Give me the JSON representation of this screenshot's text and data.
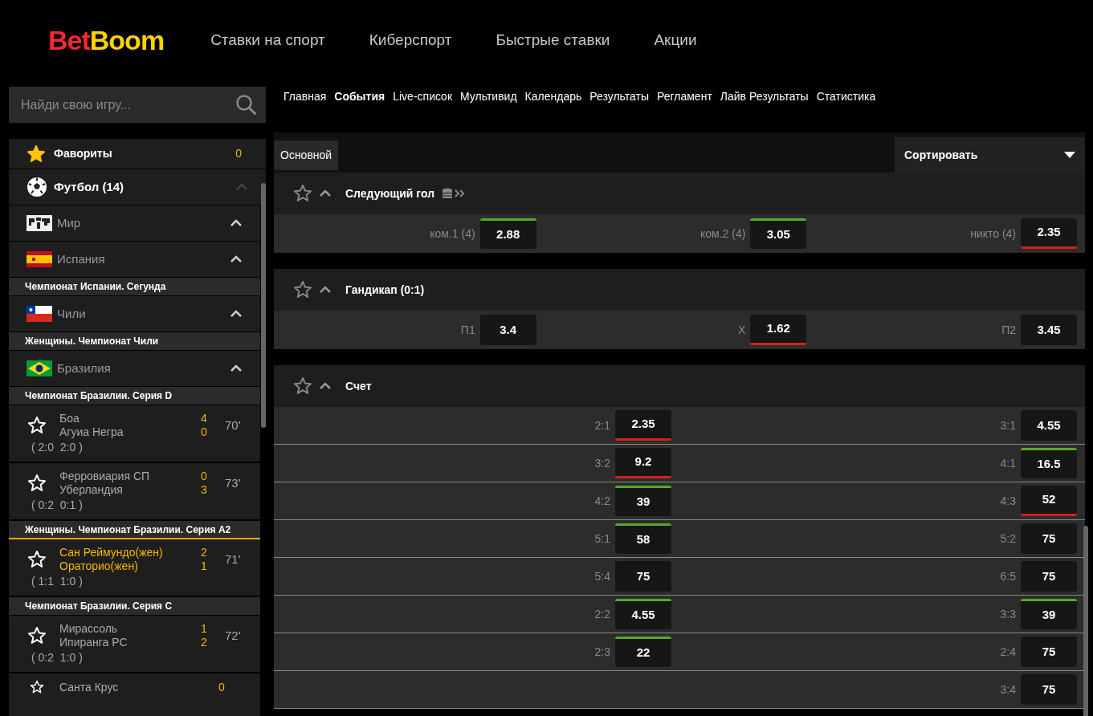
{
  "logo": {
    "parts": [
      {
        "text": "Bet",
        "color": "#ee2a35"
      },
      {
        "text": "Boom",
        "color": "#ffd200"
      }
    ]
  },
  "top_nav": [
    {
      "label": "Ставки на спорт"
    },
    {
      "label": "Киберспорт"
    },
    {
      "label": "Быстрые ставки"
    },
    {
      "label": "Акции"
    }
  ],
  "search": {
    "placeholder": "Найди свою игру..."
  },
  "sub_nav": [
    {
      "label": "Главная",
      "selected": false
    },
    {
      "label": "События",
      "selected": true
    },
    {
      "label": "Live-список",
      "selected": false
    },
    {
      "label": "Мультивид",
      "selected": false
    },
    {
      "label": "Календарь",
      "selected": false
    },
    {
      "label": "Результаты",
      "selected": false
    },
    {
      "label": "Регламент",
      "selected": false
    },
    {
      "label": "Лайв Результаты",
      "selected": false
    },
    {
      "label": "Статистика",
      "selected": false
    }
  ],
  "sidebar": {
    "items": [
      {
        "kind": "favorites",
        "label": "Фавориты",
        "count": "0"
      },
      {
        "kind": "sport",
        "label": "Футбол (14)",
        "expanded": true
      },
      {
        "kind": "country",
        "label": "Мир",
        "expanded": true
      },
      {
        "kind": "country",
        "label": "Испания",
        "expanded": true
      },
      {
        "kind": "league",
        "label": "Чемпионат Испании. Сегунда",
        "selected": false
      },
      {
        "kind": "country",
        "label": "Чили",
        "expanded": true
      },
      {
        "kind": "league",
        "label": "Женщины. Чемпионат Чили",
        "selected": false
      },
      {
        "kind": "country",
        "label": "Бразилия",
        "expanded": true
      },
      {
        "kind": "league",
        "label": "Чемпионат Бразилии. Серия D",
        "selected": false
      },
      {
        "kind": "match",
        "favorite": false,
        "selected": false,
        "team1": "Боа",
        "team2": "Агуиа Негра",
        "score1": "4",
        "score2": "0",
        "time": "70'",
        "periods": "( 2:0  2:0 )"
      },
      {
        "kind": "match",
        "favorite": false,
        "selected": false,
        "team1": "Ферровиария СП",
        "team2": "Уберландия",
        "score1": "0",
        "score2": "3",
        "time": "73'",
        "periods": "( 0:2  0:1 )"
      },
      {
        "kind": "league",
        "label": "Женщины. Чемпионат Бразилии. Серия А2",
        "selected": true
      },
      {
        "kind": "match",
        "favorite": false,
        "selected": true,
        "team1": "Сан Реймундо(жен)",
        "team2": "Ораторио(жен)",
        "score1": "2",
        "score2": "1",
        "time": "71'",
        "periods": "( 1:1  1:0 )"
      },
      {
        "kind": "league",
        "label": "Чемпионат Бразилии. Серия С",
        "selected": false
      },
      {
        "kind": "match",
        "favorite": false,
        "selected": false,
        "team1": "Мирассоль",
        "team2": "Ипиранга РС",
        "score1": "1",
        "score2": "2",
        "time": "72'",
        "periods": "( 0:2  1:0 )"
      },
      {
        "kind": "match",
        "favorite": false,
        "selected": false,
        "team1": "Санта Крус",
        "score1": "0"
      }
    ]
  },
  "main": {
    "tab": {
      "label": "Основной",
      "selected": true
    },
    "sort": {
      "label": "Сортировать"
    },
    "markets": [
      {
        "title": "Следующий гол",
        "favorite": false,
        "expanded": true,
        "coins_icon": true,
        "rows": [
          [
            {
              "label": "ком.1 (4)",
              "odds": "2.88",
              "rising": true,
              "falling": false
            },
            {
              "label": "ком.2 (4)",
              "odds": "3.05",
              "rising": true,
              "falling": false
            },
            {
              "label": "никто (4)",
              "odds": "2.35",
              "rising": false,
              "falling": true
            }
          ]
        ]
      },
      {
        "title": "Гандикап (0:1)",
        "favorite": false,
        "expanded": true,
        "coins_icon": false,
        "rows": [
          [
            {
              "label": "П1",
              "odds": "3.4",
              "rising": false,
              "falling": false
            },
            {
              "label": "X",
              "odds": "1.62",
              "rising": false,
              "falling": true
            },
            {
              "label": "П2",
              "odds": "3.45",
              "rising": false,
              "falling": false
            }
          ]
        ]
      },
      {
        "title": "Счет",
        "favorite": false,
        "expanded": true,
        "coins_icon": false,
        "rows": [
          [
            {
              "label": "2:1",
              "odds": "2.35",
              "rising": false,
              "falling": true
            },
            {
              "label": "3:1",
              "odds": "4.55",
              "rising": false,
              "falling": false
            }
          ],
          [
            {
              "label": "3:2",
              "odds": "9.2",
              "rising": false,
              "falling": true
            },
            {
              "label": "4:1",
              "odds": "16.5",
              "rising": true,
              "falling": false
            }
          ],
          [
            {
              "label": "4:2",
              "odds": "39",
              "rising": true,
              "falling": false
            },
            {
              "label": "4:3",
              "odds": "52",
              "rising": false,
              "falling": true
            }
          ],
          [
            {
              "label": "5:1",
              "odds": "58",
              "rising": true,
              "falling": false
            },
            {
              "label": "5:2",
              "odds": "75",
              "rising": false,
              "falling": false
            }
          ],
          [
            {
              "label": "5:4",
              "odds": "75",
              "rising": false,
              "falling": false
            },
            {
              "label": "6:5",
              "odds": "75",
              "rising": false,
              "falling": false
            }
          ],
          [
            {
              "label": "2:2",
              "odds": "4.55",
              "rising": true,
              "falling": false
            },
            {
              "label": "3:3",
              "odds": "39",
              "rising": true,
              "falling": false
            }
          ],
          [
            {
              "label": "2:3",
              "odds": "22",
              "rising": true,
              "falling": false
            },
            {
              "label": "2:4",
              "odds": "75",
              "rising": false,
              "falling": false
            }
          ],
          [
            "",
            {
              "label": "3:4",
              "odds": "75",
              "rising": false,
              "falling": false
            }
          ]
        ]
      }
    ]
  }
}
